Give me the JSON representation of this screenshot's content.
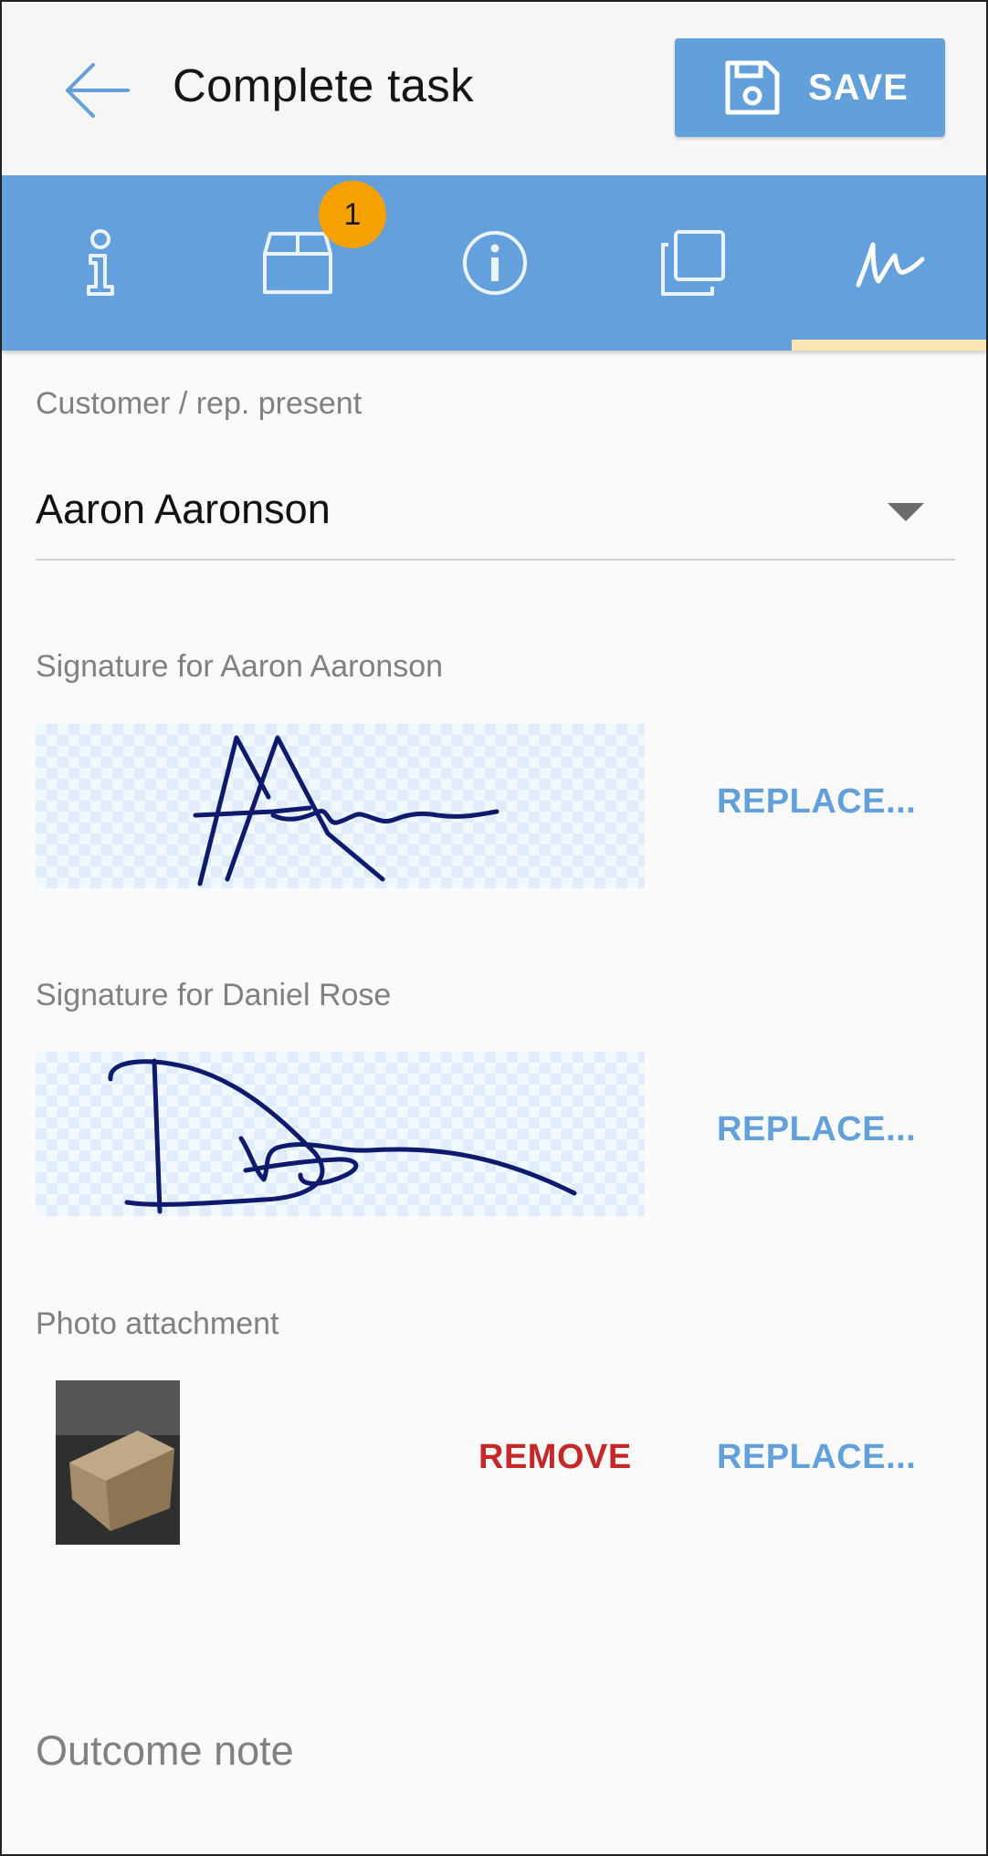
{
  "header": {
    "title": "Complete task",
    "save_label": "SAVE"
  },
  "tabs": {
    "items": [
      "info-tab",
      "package-tab",
      "details-tab",
      "copies-tab",
      "signature-tab"
    ],
    "selected": "signature-tab",
    "badge": "1"
  },
  "form": {
    "customer_label": "Customer / rep. present",
    "customer_value": "Aaron Aaronson",
    "signature1_label": "Signature for Aaron Aaronson",
    "signature2_label": "Signature for Daniel Rose",
    "photo_label": "Photo attachment",
    "replace_label": "REPLACE...",
    "remove_label": "REMOVE",
    "outcome_placeholder": "Outcome note"
  },
  "colors": {
    "accent": "#62a0db",
    "tab_bar": "#64a0db",
    "badge": "#f7a100",
    "indicator": "#fbe3b2",
    "remove": "#c62828",
    "ink": "#0d1a6e"
  }
}
